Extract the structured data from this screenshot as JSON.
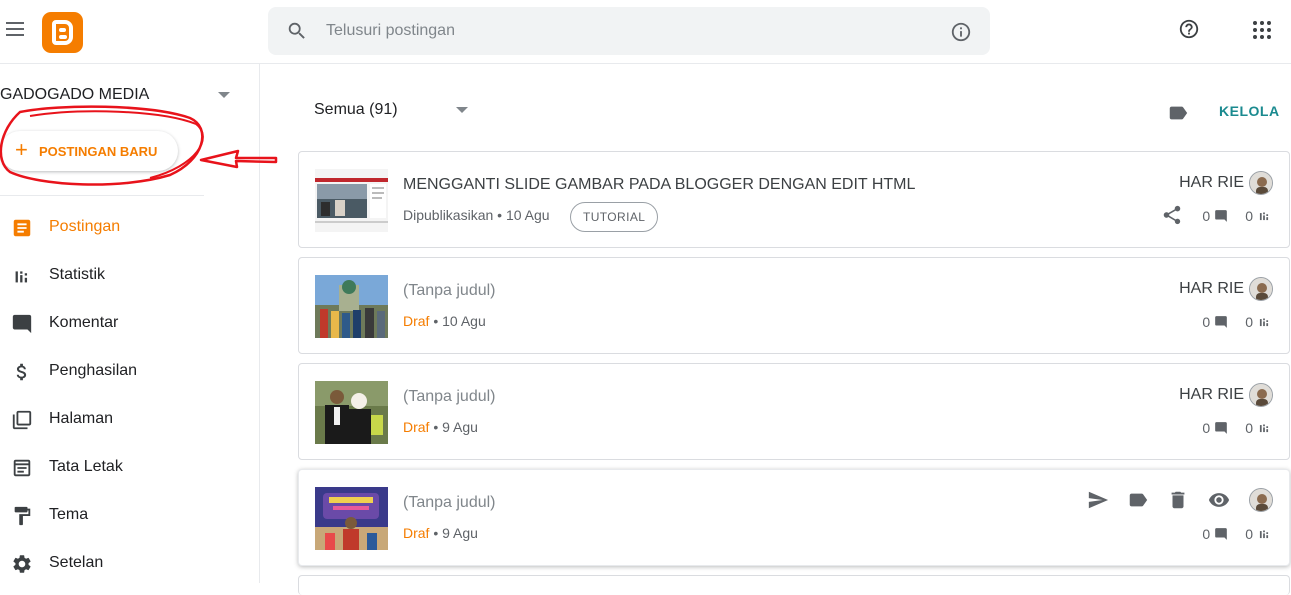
{
  "header": {
    "search_placeholder": "Telusuri postingan",
    "icons": [
      "menu-icon",
      "blogger-logo",
      "search-icon",
      "info-icon",
      "help-icon",
      "apps-icon"
    ]
  },
  "sidebar": {
    "blog_name": "GADOGADO MEDIA",
    "new_post_label": "POSTINGAN BARU",
    "items": [
      {
        "label": "Postingan",
        "icon": "posts-icon",
        "active": true
      },
      {
        "label": "Statistik",
        "icon": "stats-icon",
        "active": false
      },
      {
        "label": "Komentar",
        "icon": "comment-icon",
        "active": false
      },
      {
        "label": "Penghasilan",
        "icon": "dollar-icon",
        "active": false
      },
      {
        "label": "Halaman",
        "icon": "pages-icon",
        "active": false
      },
      {
        "label": "Tata Letak",
        "icon": "layout-icon",
        "active": false
      },
      {
        "label": "Tema",
        "icon": "theme-icon",
        "active": false
      },
      {
        "label": "Setelan",
        "icon": "settings-icon",
        "active": false
      }
    ]
  },
  "main": {
    "filter_label": "Semua (91)",
    "manage_label": "KELOLA",
    "posts": [
      {
        "title": "MENGGANTI SLIDE GAMBAR PADA BLOGGER DENGAN EDIT HTML",
        "status": "Dipublikasikan",
        "date": "10 Agu",
        "tag": "TUTORIAL",
        "author": "HAR RIE",
        "comments": "0",
        "views": "0"
      },
      {
        "title": "(Tanpa judul)",
        "status": "Draf",
        "date": "10 Agu",
        "author": "HAR RIE",
        "comments": "0",
        "views": "0"
      },
      {
        "title": "(Tanpa judul)",
        "status": "Draf",
        "date": "9 Agu",
        "author": "HAR RIE",
        "comments": "0",
        "views": "0"
      },
      {
        "title": "(Tanpa judul)",
        "status": "Draf",
        "date": "9 Agu",
        "comments": "0",
        "views": "0"
      }
    ]
  },
  "colors": {
    "accent": "#f57d00",
    "teal": "#1a8a8f",
    "annotation": "#e8131b"
  },
  "meta_separator": " • "
}
